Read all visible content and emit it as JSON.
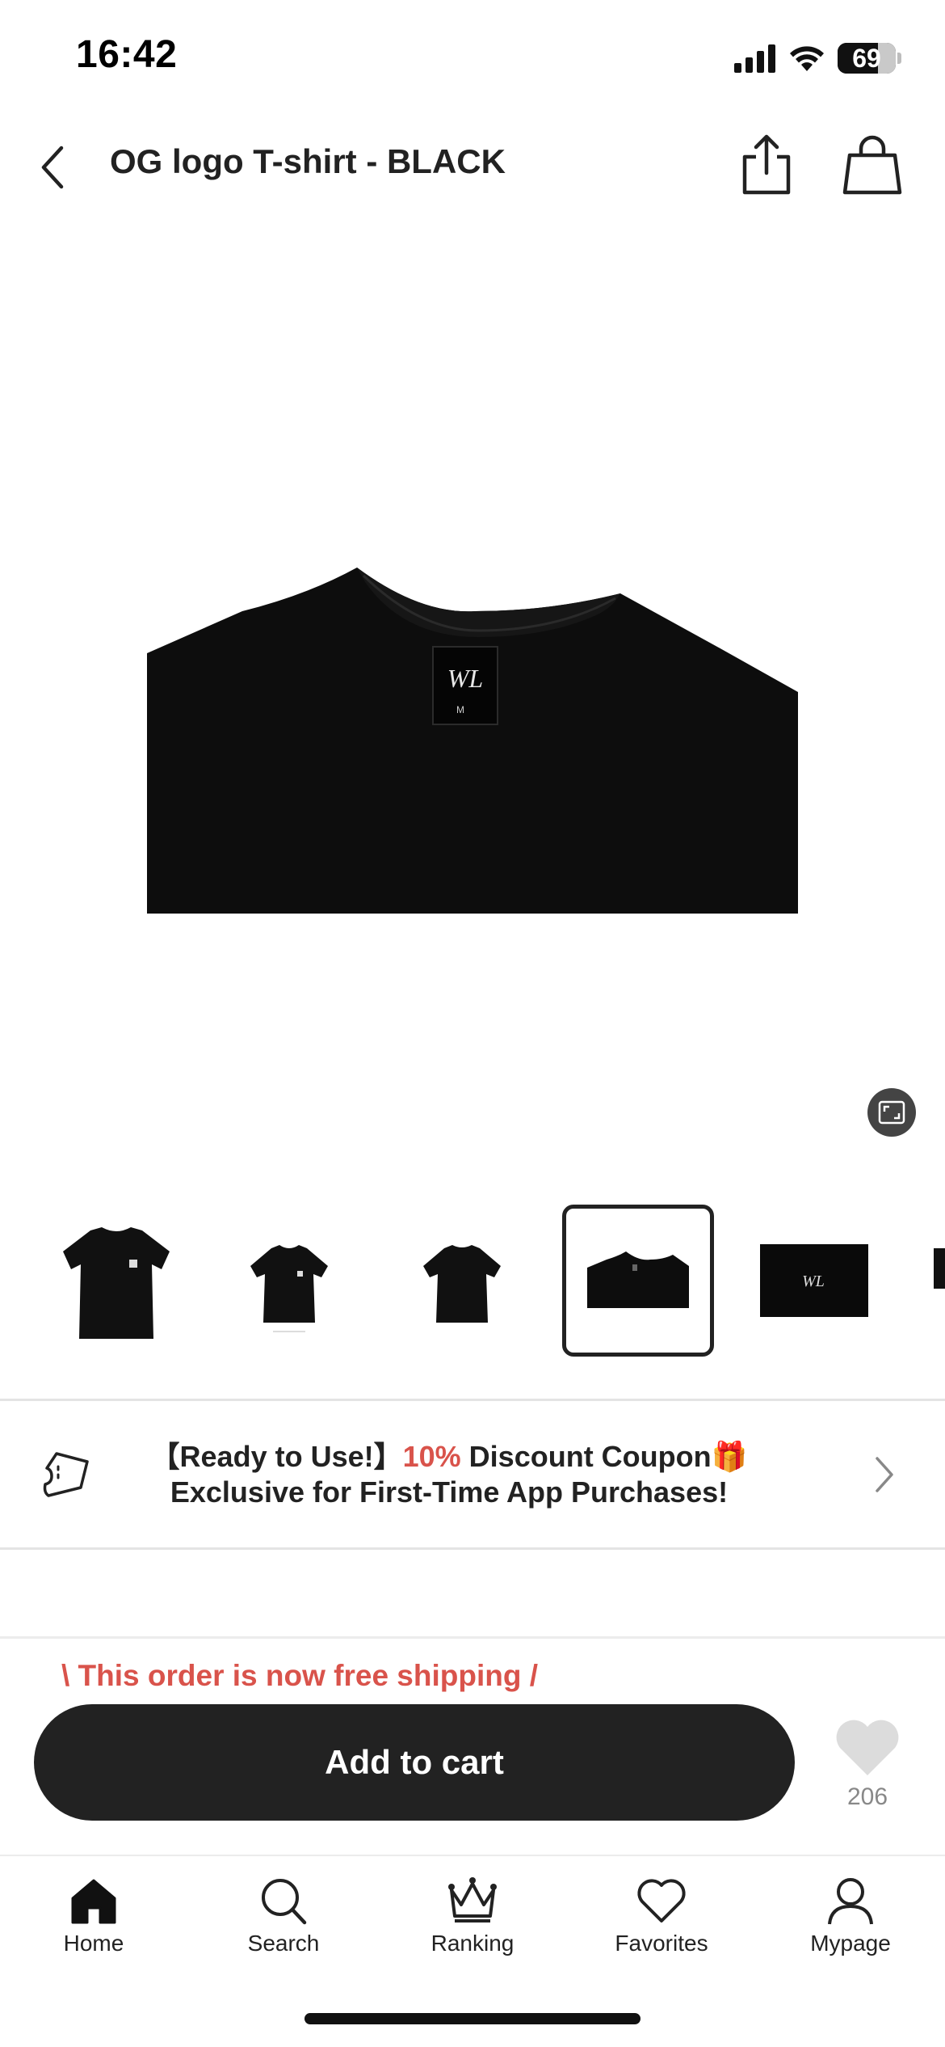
{
  "status_bar": {
    "time": "16:42",
    "battery": "69",
    "battery_level": 0.69,
    "icons": [
      "cellular-signal-icon",
      "wifi-icon",
      "battery-icon"
    ]
  },
  "header": {
    "title": "OG logo T-shirt - BLACK",
    "icons": [
      "chevron-left-icon",
      "share-icon",
      "shopping-bag-icon"
    ]
  },
  "gallery": {
    "main_label": "WL",
    "main_label_size": "M",
    "thumbnails": [
      {
        "type": "tshirt-front",
        "selected": false
      },
      {
        "type": "tshirt-front-small",
        "selected": false
      },
      {
        "type": "tshirt-back-small",
        "selected": false
      },
      {
        "type": "tshirt-collar",
        "selected": true
      },
      {
        "type": "tshirt-label",
        "selected": false
      }
    ],
    "expand_icon": "expand-icon"
  },
  "coupon": {
    "prefix": "【Ready to Use!】",
    "highlight": "10%",
    "suffix": " Discount Coupon",
    "emoji": "🎁",
    "line2": "Exclusive for First-Time App Purchases!",
    "accent_color": "#d9534b"
  },
  "purchase": {
    "free_shipping": "\\ This order is now free shipping /",
    "add_to_cart": "Add to cart",
    "favorites_count": "206"
  },
  "bottom_nav": {
    "items": [
      {
        "label": "Home",
        "icon": "home-icon"
      },
      {
        "label": "Search",
        "icon": "search-icon"
      },
      {
        "label": "Ranking",
        "icon": "crown-icon"
      },
      {
        "label": "Favorites",
        "icon": "heart-icon"
      },
      {
        "label": "Mypage",
        "icon": "user-icon"
      }
    ]
  }
}
